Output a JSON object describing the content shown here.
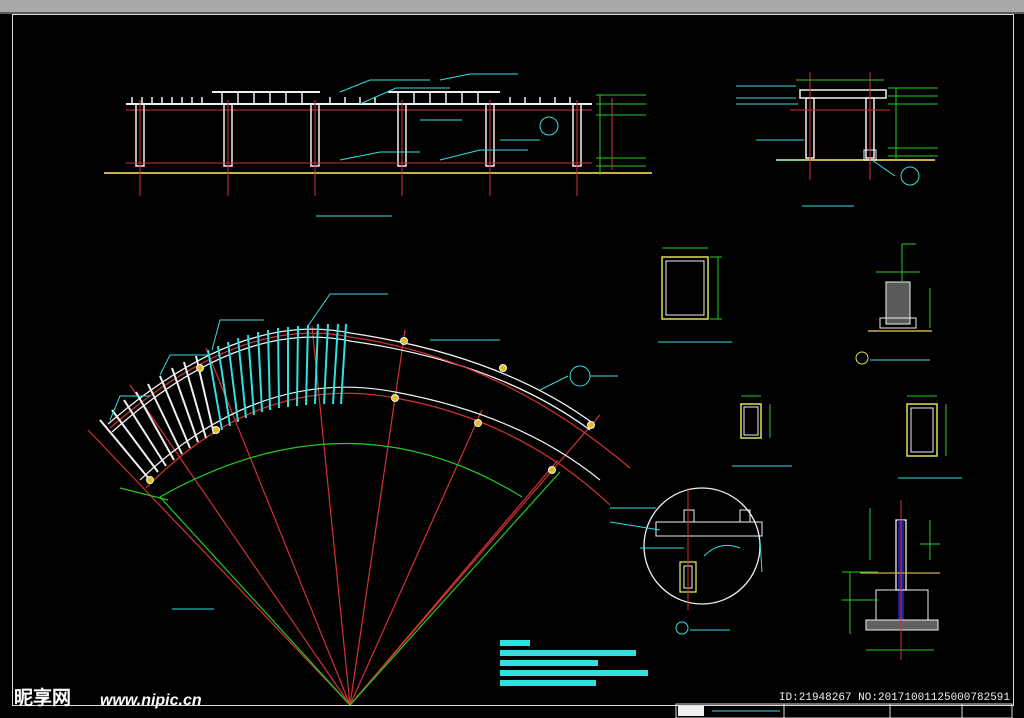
{
  "watermark": {
    "logo": "昵享网",
    "url": "www.nipic.cn",
    "id_text": "ID:21948267 NO:20171001125000782591"
  },
  "colors": {
    "background": "#000000",
    "grid_red": "#d23232",
    "guide_green": "#22cc22",
    "annot_cyan": "#33e0e0",
    "outline_white": "#f0f0f0",
    "dimension_yellow": "#e0e050",
    "ground_olive": "#c8b04a"
  },
  "drawing": {
    "views": [
      "long-elevation",
      "end-elevation",
      "arc-plan",
      "column-section-a",
      "column-section-b",
      "column-section-c",
      "footing-detail",
      "node-detail-circle",
      "base-section"
    ],
    "legend_rows": 5
  }
}
